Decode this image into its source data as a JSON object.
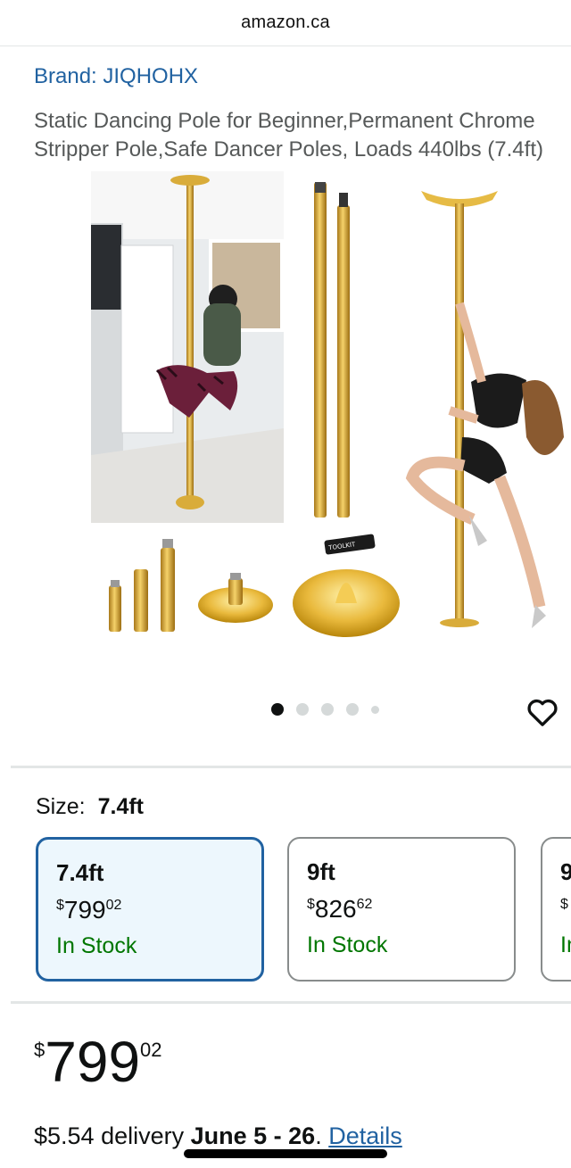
{
  "browser": {
    "url": "amazon.ca"
  },
  "product": {
    "brand": "Brand: JIQHOHX",
    "title_line1": "Static Dancing Pole for Beginner,Permanent Chrome",
    "title_line2": "Stripper Pole,Safe Dancer Poles, Loads 440lbs (7.4ft)",
    "image_count": 5,
    "active_image_index": 0,
    "toolkit_label": "TOOLKIT"
  },
  "size": {
    "label": "Size:",
    "selected": "7.4ft",
    "options": [
      {
        "name": "7.4ft",
        "currency": "$",
        "whole": "799",
        "fraction": "02",
        "stock": "In Stock",
        "selected": true
      },
      {
        "name": "9ft",
        "currency": "$",
        "whole": "826",
        "fraction": "62",
        "stock": "In Stock",
        "selected": false
      },
      {
        "name": "9",
        "currency": "$",
        "whole": "",
        "fraction": "",
        "stock": "In",
        "selected": false
      }
    ]
  },
  "price": {
    "currency": "$",
    "whole": "799",
    "fraction": "02"
  },
  "delivery": {
    "prefix": "$5.54 delivery",
    "date": "June 5 - 26",
    "separator": ".",
    "details_link": "Details"
  },
  "colors": {
    "link": "#2162a1",
    "in_stock": "#007600",
    "selected_border": "#2162a1",
    "selected_bg": "#edf7fd",
    "gold": "#d4a62a"
  },
  "icons": {
    "wishlist": "heart-icon"
  }
}
